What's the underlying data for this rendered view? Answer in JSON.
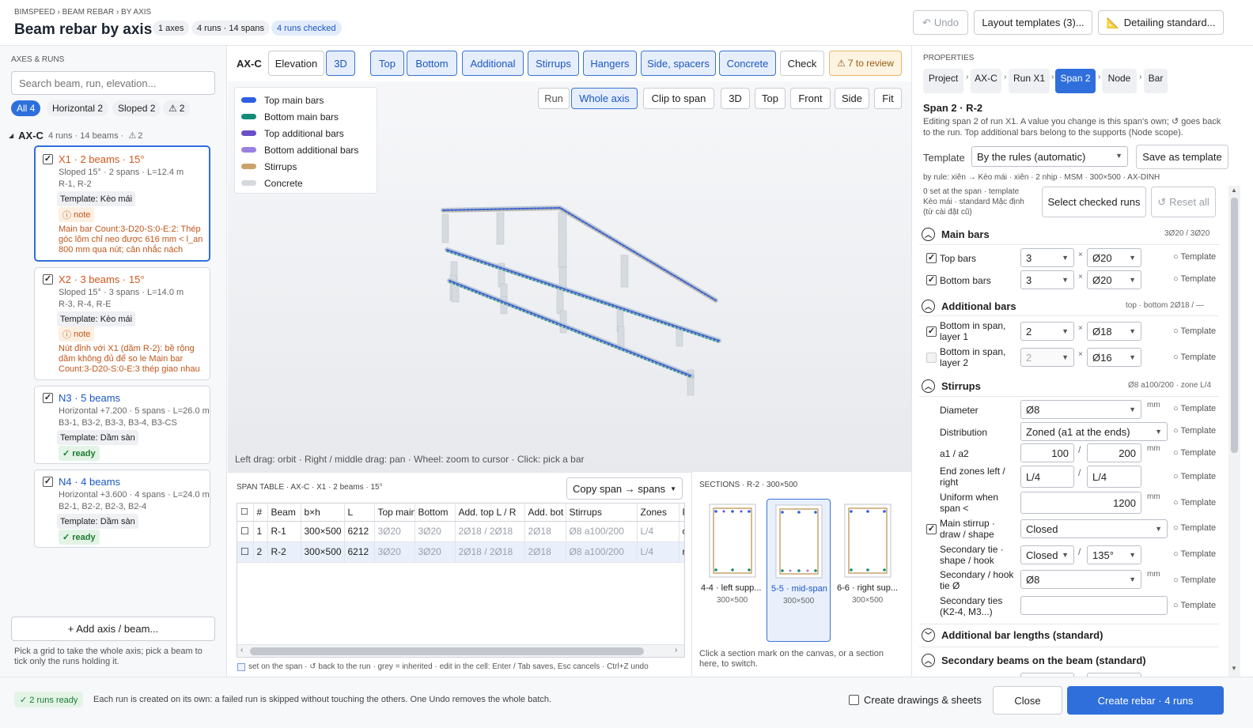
{
  "header": {
    "breadcrumb": "BIMSPEED › BEAM REBAR › BY AXIS",
    "title": "Beam rebar by axis",
    "badges": [
      "1 axes",
      "4 runs · 14 spans",
      "4 runs checked"
    ],
    "undo": "Undo",
    "layout_templates": "Layout templates (3)...",
    "detailing": "Detailing standard..."
  },
  "left": {
    "section_title": "AXES & RUNS",
    "search_placeholder": "Search beam, run, elevation...",
    "filters": [
      "All 4",
      "Horizontal 2",
      "Sloped 2",
      "2"
    ],
    "axis": {
      "name": "AX-C",
      "summary": "4 runs · 14 beams ·",
      "warn": "2"
    },
    "runs": [
      {
        "title": "X1 · 2 beams · 15°",
        "line1": "Sloped 15° · 2 spans · L=12.4 m",
        "line2": "R-1, R-2",
        "template": "Template: Kèo mái",
        "status": "note",
        "msg": "Main bar Count:3-D20-S:0-E:2: Thép góc lõm chỉ neo được 616 mm < l_an 800 mm qua nút; cân nhắc nách (vút)..."
      },
      {
        "title": "X2 · 3 beams · 15°",
        "line1": "Sloped 15° · 3 spans · L=14.0 m",
        "line2": "R-3, R-4, R-E",
        "template": "Template: Kèo mái",
        "status": "note",
        "msg": "Nút đỉnh với X1 (dầm R-2): bề rộng dầm không đủ để so le Main bar Count:3-D20-S:0-E:3 thép giao nhau v..."
      },
      {
        "title": "N3 · 5 beams",
        "line1": "Horizontal +7.200 · 5 spans · L=26.0 m",
        "line2": "B3-1, B3-2, B3-3, B3-4, B3-CS",
        "template": "Template: Dầm sàn",
        "status": "ready"
      },
      {
        "title": "N4 · 4 beams",
        "line1": "Horizontal +3.600 · 4 spans · L=24.0 m",
        "line2": "B2-1, B2-2, B2-3, B2-4",
        "template": "Template: Dầm sàn",
        "status": "ready"
      }
    ],
    "add_btn": "+ Add axis / beam...",
    "hint": "Pick a grid to take the whole axis; pick a beam to tick only the runs holding it."
  },
  "center": {
    "axis_label": "AX-C",
    "view_tabs": [
      "Elevation",
      "3D"
    ],
    "layer_tabs": [
      "Top",
      "Bottom",
      "Additional",
      "Stirrups",
      "Hangers",
      "Side, spacers",
      "Concrete"
    ],
    "check": "Check",
    "review": "7 to review",
    "legend": [
      {
        "label": "Top main bars",
        "color": "#2f5fe0"
      },
      {
        "label": "Bottom main bars",
        "color": "#138a7a"
      },
      {
        "label": "Top additional bars",
        "color": "#6a4fc7"
      },
      {
        "label": "Bottom additional bars",
        "color": "#9b7fe0"
      },
      {
        "label": "Stirrups",
        "color": "#c9a36a"
      },
      {
        "label": "Concrete",
        "color": "#d5d8dd"
      }
    ],
    "view_buttons": [
      "Run",
      "Whole axis",
      "Clip to span",
      "3D",
      "Top",
      "Front",
      "Side",
      "Fit"
    ],
    "viewport_hint": "Left drag: orbit · Right / middle drag: pan · Wheel: zoom to cursor · Click: pick a bar",
    "span_table": {
      "title": "SPAN TABLE · AX-C · X1 · 2 beams · 15°",
      "copy_btn": "Copy span → spans",
      "headers": [
        "#",
        "Beam",
        "b×h",
        "L",
        "Top main",
        "Bottom",
        "Add. top L / R",
        "Add. bot",
        "Stirrups",
        "Zones",
        "F"
      ],
      "rows": [
        [
          "1",
          "R-1",
          "300×500",
          "6212",
          "3Ø20",
          "3Ø20",
          "2Ø18 / 2Ø18",
          "2Ø18",
          "Ø8 a100/200",
          "L/4",
          "c"
        ],
        [
          "2",
          "R-2",
          "300×500",
          "6212",
          "3Ø20",
          "3Ø20",
          "2Ø18 / 2Ø18",
          "2Ø18",
          "Ø8 a100/200",
          "L/4",
          "ri"
        ]
      ],
      "legend": "set on the span · ↺ back to the run · grey = inherited · edit in the cell: Enter / Tab saves, Esc cancels · Ctrl+Z undo"
    },
    "sections": {
      "title": "SECTIONS · R-2 · 300×500",
      "items": [
        {
          "label": "4-4 · left supp...",
          "size": "300×500"
        },
        {
          "label": "5-5 · mid-span",
          "size": "300×500"
        },
        {
          "label": "6-6 · right sup...",
          "size": "300×500"
        }
      ],
      "hint": "Click a section mark on the canvas, or a section here, to switch."
    }
  },
  "right": {
    "title": "PROPERTIES",
    "crumbs": [
      "Project",
      "AX-C",
      "Run X1",
      "Span 2",
      "Node",
      "Bar"
    ],
    "span_title": "Span 2 · R-2",
    "desc": "Editing span 2 of run X1. A value you change is this span's own; ↺ goes back to the run. Top additional bars belong to the supports (Node scope).",
    "template_label": "Template",
    "template_value": "By the rules (automatic)",
    "save_template": "Save as template",
    "rule_line": "by rule: xiên → Kèo mái · xiên · 2 nhịp · MSM · 300×500 · AX-DINH",
    "set_info": "0 set at the span · template Kèo mái · standard Mặc định (từ cài đặt cũ)",
    "select_checked": "Select checked runs",
    "reset_all": "Reset all",
    "tmpl": "Template",
    "main": {
      "title": "Main bars",
      "summary": "3Ø20 / 3Ø20",
      "top_label": "Top bars",
      "top_n": "3",
      "top_d": "Ø20",
      "bot_label": "Bottom bars",
      "bot_n": "3",
      "bot_d": "Ø20"
    },
    "add": {
      "title": "Additional bars",
      "summary": "top · bottom 2Ø18 / —",
      "l1_label": "Bottom in span, layer 1",
      "l1_n": "2",
      "l1_d": "Ø18",
      "l2_label": "Bottom in span, layer 2",
      "l2_n": "2",
      "l2_d": "Ø16"
    },
    "stir": {
      "title": "Stirrups",
      "summary": "Ø8 a100/200 · zone L/4",
      "diameter_label": "Diameter",
      "diameter": "Ø8",
      "distribution_label": "Distribution",
      "distribution": "Zoned (a1 at the ends)",
      "a_label": "a1 / a2",
      "a1": "100",
      "a2": "200",
      "ends_label": "End zones left / right",
      "end_l": "L/4",
      "end_r": "L/4",
      "uniform_label": "Uniform when span <",
      "uniform": "1200",
      "main_label": "Main stirrup · draw / shape",
      "main_shape": "Closed",
      "sec_label": "Secondary tie · shape / hook",
      "sec_shape": "Closed",
      "sec_hook": "135°",
      "sec_d_label": "Secondary / hook tie Ø",
      "sec_d": "Ø8",
      "sec_ties_label": "Secondary ties (K2-4, M3...)",
      "unit": "mm"
    },
    "lengths": "Additional bar lengths (standard)",
    "secondary": "Secondary beams on the beam (standard)"
  },
  "footer": {
    "ready": "✓ 2 runs ready",
    "msg": "Each run is created on its own: a failed run is skipped without touching the others. One Undo removes the whole batch.",
    "drawings": "Create drawings & sheets",
    "close": "Close",
    "create": "Create rebar · 4 runs"
  }
}
